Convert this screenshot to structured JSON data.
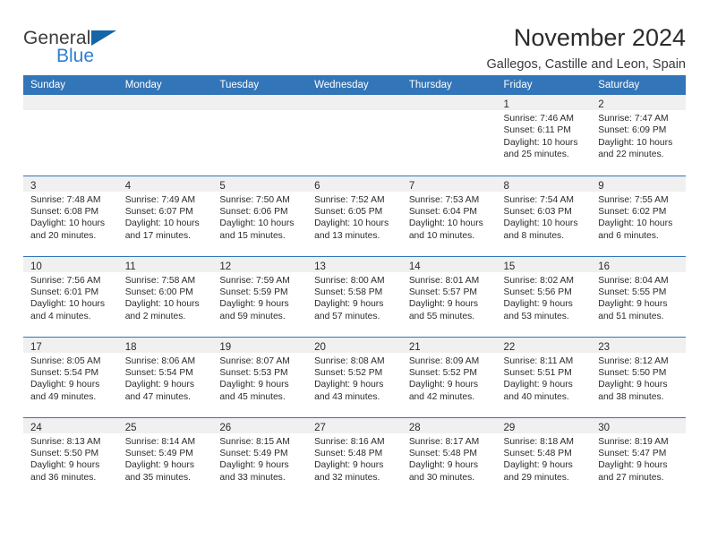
{
  "brand": {
    "word_one": "General",
    "word_two": "Blue",
    "triangle_color": "#1565a8",
    "blue_color": "#2f7fd0"
  },
  "header": {
    "title": "November 2024",
    "subtitle": "Gallegos, Castille and Leon, Spain"
  },
  "theme": {
    "header_blue": "#3275b8",
    "daynum_band": "#f0f0f0",
    "text": "#2b2b2b"
  },
  "weekday_headers": [
    "Sunday",
    "Monday",
    "Tuesday",
    "Wednesday",
    "Thursday",
    "Friday",
    "Saturday"
  ],
  "weeks": [
    [
      {
        "empty": true
      },
      {
        "empty": true
      },
      {
        "empty": true
      },
      {
        "empty": true
      },
      {
        "empty": true
      },
      {
        "empty": false,
        "day": "1",
        "sunrise": "Sunrise: 7:46 AM",
        "sunset": "Sunset: 6:11 PM",
        "daylight_a": "Daylight: 10 hours",
        "daylight_b": "and 25 minutes."
      },
      {
        "empty": false,
        "day": "2",
        "sunrise": "Sunrise: 7:47 AM",
        "sunset": "Sunset: 6:09 PM",
        "daylight_a": "Daylight: 10 hours",
        "daylight_b": "and 22 minutes."
      }
    ],
    [
      {
        "empty": false,
        "day": "3",
        "sunrise": "Sunrise: 7:48 AM",
        "sunset": "Sunset: 6:08 PM",
        "daylight_a": "Daylight: 10 hours",
        "daylight_b": "and 20 minutes."
      },
      {
        "empty": false,
        "day": "4",
        "sunrise": "Sunrise: 7:49 AM",
        "sunset": "Sunset: 6:07 PM",
        "daylight_a": "Daylight: 10 hours",
        "daylight_b": "and 17 minutes."
      },
      {
        "empty": false,
        "day": "5",
        "sunrise": "Sunrise: 7:50 AM",
        "sunset": "Sunset: 6:06 PM",
        "daylight_a": "Daylight: 10 hours",
        "daylight_b": "and 15 minutes."
      },
      {
        "empty": false,
        "day": "6",
        "sunrise": "Sunrise: 7:52 AM",
        "sunset": "Sunset: 6:05 PM",
        "daylight_a": "Daylight: 10 hours",
        "daylight_b": "and 13 minutes."
      },
      {
        "empty": false,
        "day": "7",
        "sunrise": "Sunrise: 7:53 AM",
        "sunset": "Sunset: 6:04 PM",
        "daylight_a": "Daylight: 10 hours",
        "daylight_b": "and 10 minutes."
      },
      {
        "empty": false,
        "day": "8",
        "sunrise": "Sunrise: 7:54 AM",
        "sunset": "Sunset: 6:03 PM",
        "daylight_a": "Daylight: 10 hours",
        "daylight_b": "and 8 minutes."
      },
      {
        "empty": false,
        "day": "9",
        "sunrise": "Sunrise: 7:55 AM",
        "sunset": "Sunset: 6:02 PM",
        "daylight_a": "Daylight: 10 hours",
        "daylight_b": "and 6 minutes."
      }
    ],
    [
      {
        "empty": false,
        "day": "10",
        "sunrise": "Sunrise: 7:56 AM",
        "sunset": "Sunset: 6:01 PM",
        "daylight_a": "Daylight: 10 hours",
        "daylight_b": "and 4 minutes."
      },
      {
        "empty": false,
        "day": "11",
        "sunrise": "Sunrise: 7:58 AM",
        "sunset": "Sunset: 6:00 PM",
        "daylight_a": "Daylight: 10 hours",
        "daylight_b": "and 2 minutes."
      },
      {
        "empty": false,
        "day": "12",
        "sunrise": "Sunrise: 7:59 AM",
        "sunset": "Sunset: 5:59 PM",
        "daylight_a": "Daylight: 9 hours",
        "daylight_b": "and 59 minutes."
      },
      {
        "empty": false,
        "day": "13",
        "sunrise": "Sunrise: 8:00 AM",
        "sunset": "Sunset: 5:58 PM",
        "daylight_a": "Daylight: 9 hours",
        "daylight_b": "and 57 minutes."
      },
      {
        "empty": false,
        "day": "14",
        "sunrise": "Sunrise: 8:01 AM",
        "sunset": "Sunset: 5:57 PM",
        "daylight_a": "Daylight: 9 hours",
        "daylight_b": "and 55 minutes."
      },
      {
        "empty": false,
        "day": "15",
        "sunrise": "Sunrise: 8:02 AM",
        "sunset": "Sunset: 5:56 PM",
        "daylight_a": "Daylight: 9 hours",
        "daylight_b": "and 53 minutes."
      },
      {
        "empty": false,
        "day": "16",
        "sunrise": "Sunrise: 8:04 AM",
        "sunset": "Sunset: 5:55 PM",
        "daylight_a": "Daylight: 9 hours",
        "daylight_b": "and 51 minutes."
      }
    ],
    [
      {
        "empty": false,
        "day": "17",
        "sunrise": "Sunrise: 8:05 AM",
        "sunset": "Sunset: 5:54 PM",
        "daylight_a": "Daylight: 9 hours",
        "daylight_b": "and 49 minutes."
      },
      {
        "empty": false,
        "day": "18",
        "sunrise": "Sunrise: 8:06 AM",
        "sunset": "Sunset: 5:54 PM",
        "daylight_a": "Daylight: 9 hours",
        "daylight_b": "and 47 minutes."
      },
      {
        "empty": false,
        "day": "19",
        "sunrise": "Sunrise: 8:07 AM",
        "sunset": "Sunset: 5:53 PM",
        "daylight_a": "Daylight: 9 hours",
        "daylight_b": "and 45 minutes."
      },
      {
        "empty": false,
        "day": "20",
        "sunrise": "Sunrise: 8:08 AM",
        "sunset": "Sunset: 5:52 PM",
        "daylight_a": "Daylight: 9 hours",
        "daylight_b": "and 43 minutes."
      },
      {
        "empty": false,
        "day": "21",
        "sunrise": "Sunrise: 8:09 AM",
        "sunset": "Sunset: 5:52 PM",
        "daylight_a": "Daylight: 9 hours",
        "daylight_b": "and 42 minutes."
      },
      {
        "empty": false,
        "day": "22",
        "sunrise": "Sunrise: 8:11 AM",
        "sunset": "Sunset: 5:51 PM",
        "daylight_a": "Daylight: 9 hours",
        "daylight_b": "and 40 minutes."
      },
      {
        "empty": false,
        "day": "23",
        "sunrise": "Sunrise: 8:12 AM",
        "sunset": "Sunset: 5:50 PM",
        "daylight_a": "Daylight: 9 hours",
        "daylight_b": "and 38 minutes."
      }
    ],
    [
      {
        "empty": false,
        "day": "24",
        "sunrise": "Sunrise: 8:13 AM",
        "sunset": "Sunset: 5:50 PM",
        "daylight_a": "Daylight: 9 hours",
        "daylight_b": "and 36 minutes."
      },
      {
        "empty": false,
        "day": "25",
        "sunrise": "Sunrise: 8:14 AM",
        "sunset": "Sunset: 5:49 PM",
        "daylight_a": "Daylight: 9 hours",
        "daylight_b": "and 35 minutes."
      },
      {
        "empty": false,
        "day": "26",
        "sunrise": "Sunrise: 8:15 AM",
        "sunset": "Sunset: 5:49 PM",
        "daylight_a": "Daylight: 9 hours",
        "daylight_b": "and 33 minutes."
      },
      {
        "empty": false,
        "day": "27",
        "sunrise": "Sunrise: 8:16 AM",
        "sunset": "Sunset: 5:48 PM",
        "daylight_a": "Daylight: 9 hours",
        "daylight_b": "and 32 minutes."
      },
      {
        "empty": false,
        "day": "28",
        "sunrise": "Sunrise: 8:17 AM",
        "sunset": "Sunset: 5:48 PM",
        "daylight_a": "Daylight: 9 hours",
        "daylight_b": "and 30 minutes."
      },
      {
        "empty": false,
        "day": "29",
        "sunrise": "Sunrise: 8:18 AM",
        "sunset": "Sunset: 5:48 PM",
        "daylight_a": "Daylight: 9 hours",
        "daylight_b": "and 29 minutes."
      },
      {
        "empty": false,
        "day": "30",
        "sunrise": "Sunrise: 8:19 AM",
        "sunset": "Sunset: 5:47 PM",
        "daylight_a": "Daylight: 9 hours",
        "daylight_b": "and 27 minutes."
      }
    ]
  ]
}
